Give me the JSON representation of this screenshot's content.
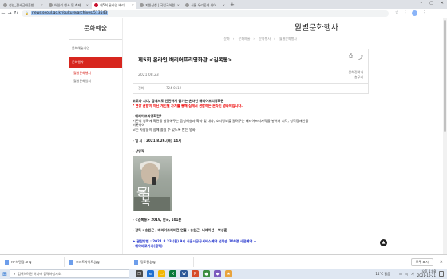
{
  "browser": {
    "tabs": [
      {
        "title": "청년_전세금대출반환_공보관_보도자료",
        "active": false
      },
      {
        "title": "어일리 행사 및 축제 | 서울특별시",
        "active": false
      },
      {
        "title": "제5회 온라인 배리어프리영화관",
        "active": true
      },
      {
        "title": "지원신청 | 국립국어원",
        "active": false
      },
      {
        "title": "서울 우리동네 쉬어",
        "active": false
      }
    ],
    "new_tab": "+",
    "window_controls": [
      "–",
      "▢",
      "✕"
    ],
    "url": "news.seoul.go.kr/culture/archives/513543",
    "nav": {
      "back": "←",
      "forward": "→",
      "reload": "↻"
    }
  },
  "sidebar": {
    "title": "문화예술",
    "items": [
      "문화예술사업",
      "문화행사"
    ],
    "sub_items": [
      "월별문화행사",
      "월별문화일지"
    ]
  },
  "page": {
    "heading": "월별문화행사",
    "breadcrumb": [
      "문화",
      "문화예술",
      "문화행사",
      "월별문화행사"
    ]
  },
  "article": {
    "title": "제5회 온라인 배리어프리영화관 <김복동>",
    "date": "2021.08.23",
    "dept": [
      "문화정책과",
      "총무과"
    ],
    "phone_label": "전화",
    "phone": "724-0112",
    "intro": "코로나 시대, 집에서도 안전하게 즐기는 온라인 배리어프리영화관",
    "notice": "* 현장 관람이 아닌 개인별 가기를 통해 집에서 관람하는 온라인 영화제입니다.",
    "section1_heading": "- 배리어프리영화란?",
    "section1_lines": [
      "기존의 영화에 화면을 설명해주는 음성해설과 화자 및 대사, 소리정보를 알려주는 배리어프리자막을 넣어서 시각, 청각장애인을",
      "비롯하여",
      "모든 사람들이 함께 즐길 수 있도록 만든 영화"
    ],
    "date_line": "- 일 시 : 2021.8.26.(목) 14시",
    "film_heading": "- 상영작",
    "poster_title": "김복동",
    "film_info": "- <김복동> 2019, 한국, 101분",
    "credits": "- 감독 : 송원근 , 배리어프리버전 연출 : 송원근, 내레이션 : 박성훈",
    "register": "★ 관람방법 : 2021.8.23.(월) 9시 서울시공공서비스예약 선착순 200명 사전예약 ★",
    "register_link": "- 예약바로가기(클릭)"
  },
  "downloads": {
    "items": [
      "re-브랜딩.png",
      "스마트사이트.jpg",
      "정도권.jpg"
    ],
    "show_all": "모두 표시",
    "close": "✕"
  },
  "taskbar": {
    "search_placeholder": "검색하려면 여기에 입력하십시오.",
    "weather": "14°C 맑음",
    "lang": "가",
    "time": "오후 1:08",
    "date": "2021-10-21"
  }
}
